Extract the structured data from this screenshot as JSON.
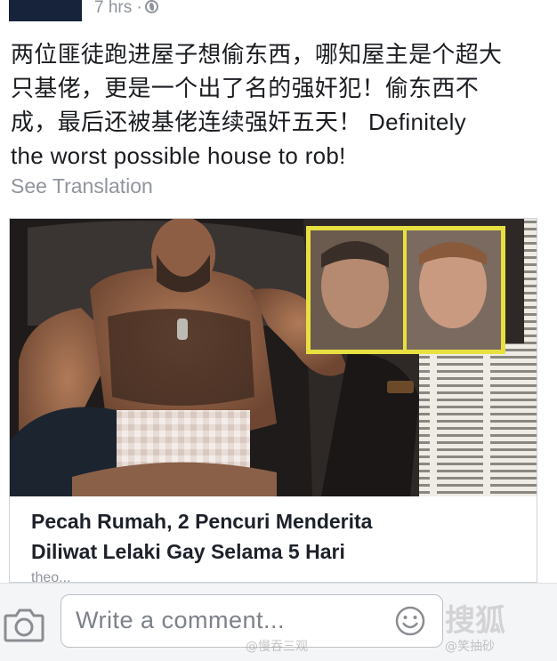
{
  "post": {
    "timestamp": "7 hrs ·",
    "icon": "globe-icon",
    "text_line1": "两位匪徒跑进屋子想偷东西，哪知屋主是个超大",
    "text_line2": "只基佬，更是一个出了名的强奸犯！偷东西不",
    "text_line3": "成，最后还被基佬连续强奸五天！ Definitely",
    "text_line4": "the worst possible house to rob!",
    "see_translation": "See Translation"
  },
  "link_card": {
    "headline_line1": "Pecah Rumah, 2 Pencuri Menderita",
    "headline_line2": "Diliwat Lelaki Gay Selama 5 Hari",
    "domain": "theo..."
  },
  "comment_bar": {
    "camera_icon": "camera-icon",
    "placeholder": "Write a comment...",
    "emoji_icon": "smiley-icon"
  },
  "watermarks": {
    "big": "搜狐",
    "weibo_left": "@慢吞三观",
    "weibo_right": "@笑抽砂"
  },
  "colors": {
    "text": "#1d2129",
    "muted": "#90949c",
    "comment_bg": "#f4f5f7",
    "highlight_frame": "#e8e040"
  }
}
